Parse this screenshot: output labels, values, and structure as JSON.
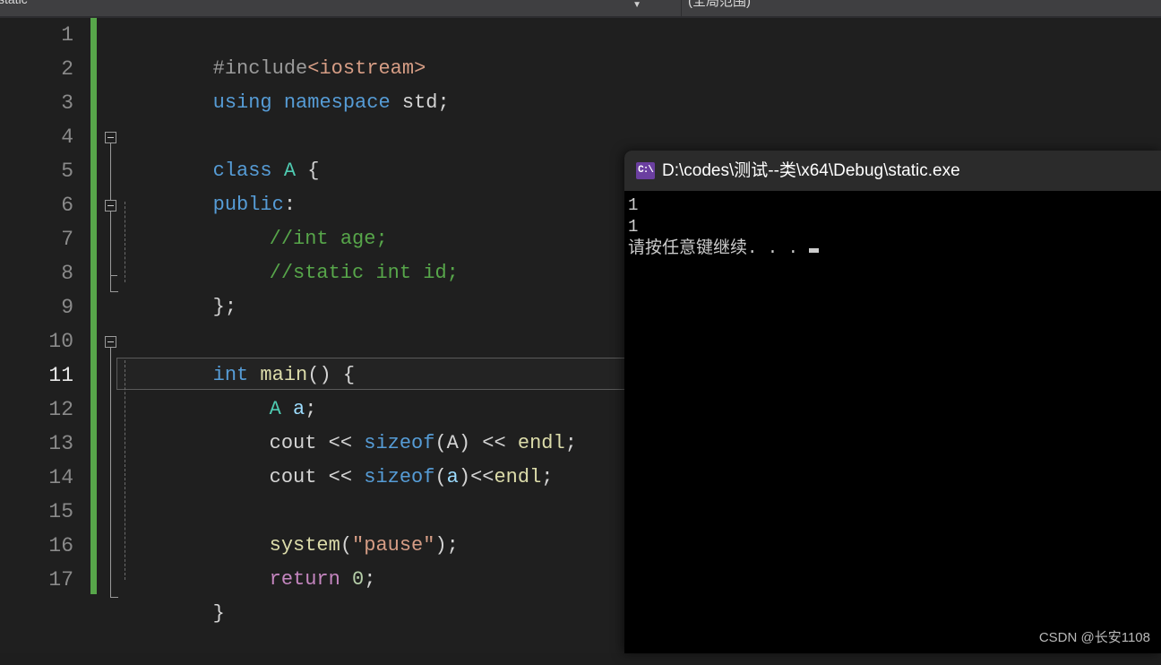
{
  "nav_bar": {
    "scope_selector_value": "static",
    "scope_selector_arrow": "▼",
    "member_selector_value": "(全局范围)"
  },
  "editor": {
    "lines": [
      {
        "number": "1",
        "current": false
      },
      {
        "number": "2",
        "current": false
      },
      {
        "number": "3",
        "current": false
      },
      {
        "number": "4",
        "current": false
      },
      {
        "number": "5",
        "current": false
      },
      {
        "number": "6",
        "current": false
      },
      {
        "number": "7",
        "current": false
      },
      {
        "number": "8",
        "current": false
      },
      {
        "number": "9",
        "current": false
      },
      {
        "number": "10",
        "current": false
      },
      {
        "number": "11",
        "current": true
      },
      {
        "number": "12",
        "current": false
      },
      {
        "number": "13",
        "current": false
      },
      {
        "number": "14",
        "current": false
      },
      {
        "number": "15",
        "current": false
      },
      {
        "number": "16",
        "current": false
      },
      {
        "number": "17",
        "current": false
      }
    ],
    "code": {
      "l1_pre": "#include",
      "l1_str": "<iostream>",
      "l2_kw": "using namespace",
      "l2_plain": " std;",
      "l4_kw": "class",
      "l4_type": " A",
      "l4_punct": " {",
      "l5_kw": "public",
      "l5_punct": ":",
      "l6_cmt": "//int age;",
      "l7_cmt": "//static int id;",
      "l8_punct": "};",
      "l10_kw": "int",
      "l10_fn": " main",
      "l10_punct": "() {",
      "l11_type": "A",
      "l11_var": " a",
      "l11_punct": ";",
      "l12_plain": "cout << ",
      "l12_kw": "sizeof",
      "l12_punct1": "(",
      "l12_type": "A",
      "l12_punct2": ") << ",
      "l12_fn": "endl",
      "l12_punct3": ";",
      "l13_plain": "cout << ",
      "l13_kw": "sizeof",
      "l13_punct1": "(",
      "l13_var": "a",
      "l13_punct2": ")<<",
      "l13_fn": "endl",
      "l13_punct3": ";",
      "l15_fn": "system",
      "l15_punct1": "(",
      "l15_str": "\"pause\"",
      "l15_punct2": ");",
      "l16_kw": "return",
      "l16_num": " 0",
      "l16_punct": ";",
      "l17_punct": "}"
    }
  },
  "console": {
    "icon_label": "C:\\",
    "title": "D:\\codes\\测试--类\\x64\\Debug\\static.exe",
    "output_lines": [
      "1",
      "1"
    ],
    "prompt_line": "请按任意键继续. . ."
  },
  "watermark": {
    "text": "CSDN @长安1108"
  }
}
